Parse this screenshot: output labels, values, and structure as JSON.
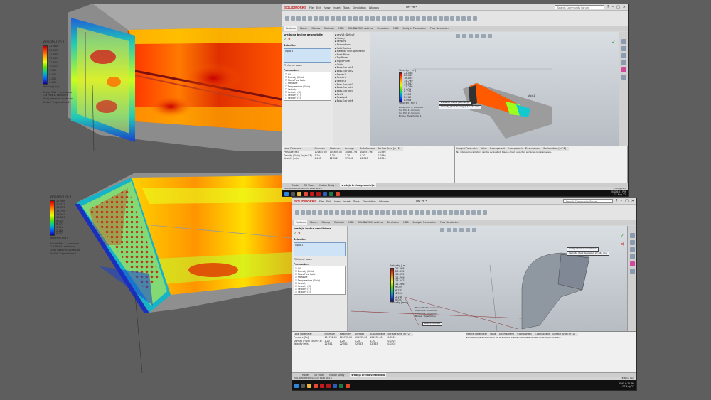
{
  "colors": {
    "background": "#5e5e5e",
    "accent": "#c81a1a",
    "legend_top": "#c00000",
    "legend_bottom": "#1200a8"
  },
  "render_top": {
    "legend": {
      "title": "Velocity [ m ]",
      "ticks": [
        "22.568",
        "20.000",
        "17.500",
        "15.000",
        "12.500",
        "10.000",
        "7.500",
        "5.000",
        "2.500",
        "0.000"
      ],
      "unit_label": "Velocity [m/s]",
      "footer": [
        "Bruise Plot 1: contours",
        "Cut Plot 1: contours",
        "(Sec) general: contours",
        "Bruise: Trajectories 1"
      ]
    }
  },
  "render_bottom": {
    "legend": {
      "title": "Velocity [ m ]",
      "ticks": [
        "22.568",
        "20.312",
        "18.055",
        "15.799",
        "13.542",
        "11.286",
        "9.029",
        "6.773",
        "4.516",
        "2.260",
        "0.003"
      ],
      "unit_label": "Velocity [m/s]",
      "footer": [
        "Bruise Plot 1: contours",
        "Cut Plot 1: contours",
        "(Sec) general: contours",
        "Bruise: Trajectories 1"
      ]
    }
  },
  "win1": {
    "logo": "SOLIDWORKS",
    "menu": [
      "File",
      "Edit",
      "View",
      "Insert",
      "Tools",
      "Simulation",
      "Window"
    ],
    "doc_title": "cev V6 *",
    "search_placeholder": "Search Community Forum",
    "tabs": [
      "Features",
      "Sketch",
      "Markup",
      "Evaluate",
      "MBD",
      "SOLIDWORKS Add-Ins",
      "Simulation",
      "MBD",
      "Analysis Preparation",
      "Flow Simulation"
    ],
    "active_tab": "Features",
    "pm_title": "sredstva brzine geometrije",
    "selection_label": "Selection",
    "selection_item": "Input 1",
    "use_all_faces": "Use all faces",
    "parameters_label": "Parameters",
    "parameters": [
      "All",
      "Density (Fluid)",
      "Mass Flow Rate",
      "Pressure",
      "Temperature (Fluid)",
      "Velocity",
      "Velocity (X)",
      "Velocity (Y)",
      "Velocity (Z)"
    ],
    "tree": [
      "cev V6 (Default)",
      "History",
      "Sensors",
      "Annotations",
      "Solid Bodies",
      "Material <not specified>",
      "Front Plane",
      "Top Plane",
      "Right Plane",
      "Origin",
      "Boss-Extrude1",
      "Boss-Extrude2",
      "Sweep1",
      "Section1",
      "Sketch3",
      "Boss-Extrude3",
      "Boss-Extrude4",
      "Boss-Extrude5",
      "Axis1",
      "Revolve1",
      "Boss-Extrude6"
    ],
    "legend_title": "Velocity [ m ]",
    "legend_ticks": [
      "22.568",
      "20.312",
      "18.055",
      "15.799",
      "13.542",
      "11.286",
      "9.029",
      "6.773",
      "4.516",
      "2.260",
      "0.003"
    ],
    "legend_unit": "Velocity [m/s]",
    "legend_footer": [
      "Bruise Plot 1: contours",
      "Cut Plot 1: contours",
      "Cut Plot 2: contours",
      "Bruise: Trajectories 1"
    ],
    "callout_1": "sredstva brzine geometrije",
    "callout_2": "Velocity (Bulk Average): 16.513 m/s",
    "callout_3": "Axis1",
    "local_table": {
      "headers": [
        "Local Parameter",
        "Minimum",
        "Maximum",
        "Average",
        "Bulk Average",
        "Surface Area [m^2]"
      ],
      "rows": [
        [
          "Pressure [Pa]",
          "101657.00",
          "101659.00",
          "101657.96",
          "101657.96",
          "0.0396"
        ],
        [
          "Density (Fluid) [kg/m^3]",
          "1.20",
          "1.20",
          "1.20",
          "1.20",
          "0.0396"
        ],
        [
          "Velocity [m/s]",
          "0.465",
          "22.562",
          "17.546",
          "16.513",
          "0.0396"
        ]
      ]
    },
    "integral_table": {
      "headers": [
        "Integral Parameter",
        "Value",
        "X-component",
        "Y-component",
        "Z-component",
        "Surface Area [m^2]"
      ],
      "note": "No integral parameters can be evaluated. Please check selected surfaces or parameters."
    },
    "bottom_tabs": [
      "Model",
      "3D Views",
      "Motion Study 1",
      "srednja brzina geometrije"
    ],
    "active_bottom_tab": "srednja brzina geometrije",
    "status_left": "SOLIDWORKS Premium 2020 SP4.0",
    "status_right": "Editing Part",
    "clock_time": "6:21 PM",
    "clock_date": "07-Aug-22",
    "lang": "ENG"
  },
  "win2": {
    "logo": "SOLIDWORKS",
    "menu": [
      "File",
      "Edit",
      "View",
      "Insert",
      "Tools",
      "Simulation",
      "Window"
    ],
    "doc_title": "cev V6 *",
    "search_placeholder": "Search Community Forum",
    "tabs": [
      "Features",
      "Sketch",
      "Markup",
      "Evaluate",
      "MBD",
      "SOLIDWORKS Add-Ins",
      "Simulation",
      "MBD",
      "Analysis Preparation",
      "Flow Simulation"
    ],
    "active_tab": "Features",
    "pm_title": "srednja brzina ventilatora",
    "selection_label": "Selection",
    "selection_item": "Input 1",
    "use_all_faces": "Use all faces",
    "parameters_label": "Parameters",
    "parameters": [
      "All",
      "Density (Fluid)",
      "Mass Flow Rate",
      "Pressure",
      "Temperature (Fluid)",
      "Velocity",
      "Velocity (X)",
      "Velocity (Y)",
      "Velocity (Z)"
    ],
    "legend_title": "Velocity [ m ]",
    "legend_ticks": [
      "22.568",
      "20.312",
      "18.055",
      "15.799",
      "13.542",
      "11.286",
      "9.029",
      "6.773",
      "4.516",
      "2.260",
      "0.003"
    ],
    "legend_unit": "Velocity [m/s]",
    "legend_footer": [
      "Bruise Plot 1: contours",
      "Cut Plot 1: contours",
      "Cut Plot 2: contours",
      "Bruise: Trajectories 1"
    ],
    "callout_1": "srednja brzina ventilatora",
    "callout_2": "Velocity (Bulk Average): 22.563 m/s",
    "callout_3": "Boss-Extrude4",
    "local_table": {
      "headers": [
        "Local Parameter",
        "Minimum",
        "Maximum",
        "Average",
        "Bulk Average",
        "Surface Area [m^2]"
      ],
      "rows": [
        [
          "Pressure [Pa]",
          "101731.00",
          "101737.00",
          "101935.00",
          "101935.00",
          "0.0205"
        ],
        [
          "Density (Fluid) [kg/m^3]",
          "1.20",
          "1.20",
          "1.20",
          "1.20",
          "0.0205"
        ],
        [
          "Velocity [m/s]",
          "22.541",
          "22.581",
          "22.563",
          "22.563",
          "0.0205"
        ]
      ]
    },
    "integral_table": {
      "headers": [
        "Integral Parameter",
        "Value",
        "X-component",
        "Y-component",
        "Z-component",
        "Surface Area [m^2]"
      ],
      "note": "No integral parameters can be evaluated. Please check selected surfaces or parameters."
    },
    "bottom_tabs": [
      "Model",
      "3D Views",
      "Motion Study 1",
      "srednja brzina ventilatora"
    ],
    "active_bottom_tab": "srednja brzina ventilatora",
    "status_left": "SOLIDWORKS Premium 2020 SP4.0",
    "status_right": "Editing Part",
    "clock_time": "6:25 PM",
    "clock_date": "07-Aug-22",
    "lang": "ENG"
  }
}
